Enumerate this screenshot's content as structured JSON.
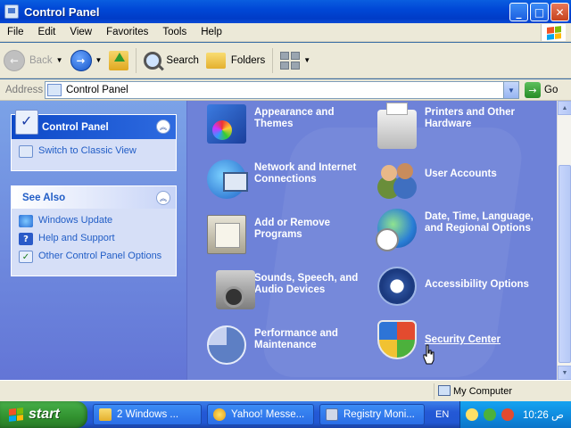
{
  "window": {
    "title": "Control Panel"
  },
  "menu": [
    "File",
    "Edit",
    "View",
    "Favorites",
    "Tools",
    "Help"
  ],
  "toolbar": {
    "back": "Back",
    "search": "Search",
    "folders": "Folders"
  },
  "address": {
    "label": "Address",
    "value": "Control Panel",
    "go": "Go"
  },
  "sidebar": {
    "control_panel": {
      "title": "Control Panel",
      "items": [
        {
          "label": "Switch to Classic View"
        }
      ]
    },
    "see_also": {
      "title": "See Also",
      "items": [
        {
          "label": "Windows Update"
        },
        {
          "label": "Help and Support"
        },
        {
          "label": "Other Control Panel Options"
        }
      ]
    }
  },
  "categories": [
    {
      "label": "Appearance and Themes",
      "icon": "appearance-icon"
    },
    {
      "label": "Printers and Other Hardware",
      "icon": "printer-icon"
    },
    {
      "label": "Network and Internet Connections",
      "icon": "network-icon"
    },
    {
      "label": "User Accounts",
      "icon": "user-accounts-icon"
    },
    {
      "label": "Add or Remove Programs",
      "icon": "add-remove-icon"
    },
    {
      "label": "Date, Time, Language, and Regional Options",
      "icon": "date-time-icon"
    },
    {
      "label": "Sounds, Speech, and Audio Devices",
      "icon": "sounds-icon"
    },
    {
      "label": "Accessibility Options",
      "icon": "accessibility-icon"
    },
    {
      "label": "Performance and Maintenance",
      "icon": "performance-icon"
    },
    {
      "label": "Security Center",
      "icon": "security-center-icon"
    }
  ],
  "status": {
    "zone": "My Computer"
  },
  "taskbar": {
    "start": "start",
    "buttons": [
      {
        "label": "2 Windows ..."
      },
      {
        "label": "Yahoo! Messe..."
      },
      {
        "label": "Registry Moni..."
      }
    ],
    "language": "EN",
    "clock": "10:26 ص"
  },
  "colors": {
    "title_bar": "#0047d6",
    "main_pane": "#6e82d8",
    "taskbar": "#2459d6",
    "start": "#31912f"
  }
}
